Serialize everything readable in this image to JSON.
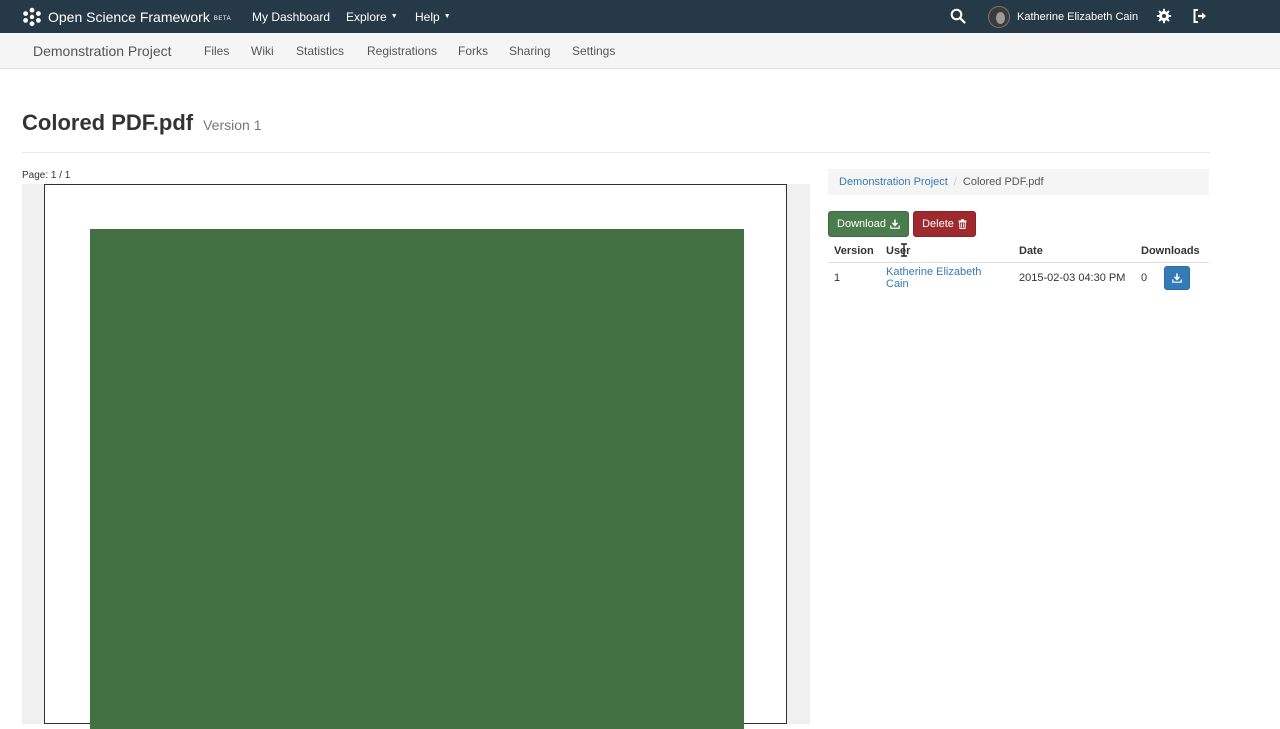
{
  "topnav": {
    "brand": "Open Science Framework",
    "beta": "BETA",
    "links": [
      "My Dashboard",
      "Explore",
      "Help"
    ],
    "user_name": "Katherine Elizabeth Cain",
    "icons": [
      "search-icon",
      "gear-icon",
      "sign-out-icon"
    ],
    "bg_color": "#263947"
  },
  "projnav": {
    "title": "Demonstration Project",
    "links": [
      "Files",
      "Wiki",
      "Statistics",
      "Registrations",
      "Forks",
      "Sharing",
      "Settings"
    ]
  },
  "file": {
    "name": "Colored PDF.pdf",
    "version_label": "Version 1",
    "page_indicator": "Page: 1 / 1",
    "content_color": "#427042"
  },
  "breadcrumb": {
    "project": "Demonstration Project",
    "file": "Colored PDF.pdf"
  },
  "actions": {
    "download_label": "Download",
    "delete_label": "Delete",
    "download_color": "#4a7c4e",
    "delete_color": "#9e2a2f"
  },
  "versions_table": {
    "headers": [
      "Version",
      "User",
      "Date",
      "Downloads"
    ],
    "rows": [
      {
        "version": "1",
        "user": "Katherine Elizabeth Cain",
        "date": "2015-02-03 04:30 PM",
        "downloads": "0"
      }
    ]
  }
}
